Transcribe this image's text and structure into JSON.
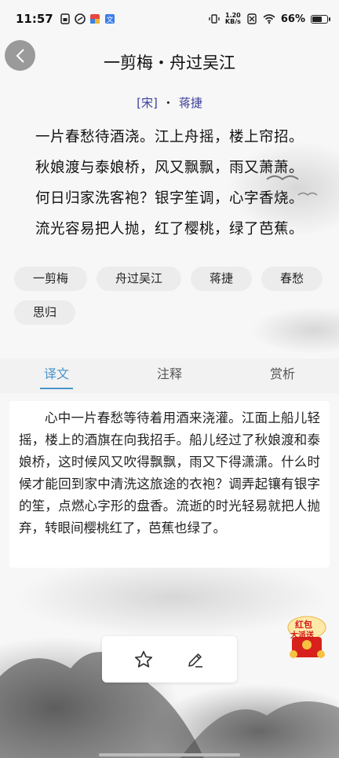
{
  "status_bar": {
    "time": "11:57",
    "net_speed_value": "1.20",
    "net_speed_unit": "KB/s",
    "battery": "66%",
    "battery_level": 0.66
  },
  "header": {
    "title": "一剪梅・舟过吴江",
    "dynasty": "[宋]",
    "separator": "・",
    "author": "蒋捷"
  },
  "poem": {
    "lines": [
      "一片春愁待酒浇。江上舟摇，楼上帘招。",
      "秋娘渡与泰娘桥，风又飘飘，雨又萧萧。",
      "何日归家洗客袍？银字笙调，心字香烧。",
      "流光容易把人抛，红了樱桃，绿了芭蕉。"
    ]
  },
  "tags": [
    "一剪梅",
    "舟过吴江",
    "蒋捷",
    "春愁",
    "思归"
  ],
  "tabs": [
    {
      "label": "译文",
      "active": true
    },
    {
      "label": "注释",
      "active": false
    },
    {
      "label": "赏析",
      "active": false
    }
  ],
  "translation": "心中一片春愁等待着用酒来浇灌。江面上船儿轻摇，楼上的酒旗在向我招手。船儿经过了秋娘渡和泰娘桥，这时候风又吹得飘飘，雨又下得潇潇。什么时候才能回到家中清洗这旅途的衣袍？调弄起镶有银字的笙，点燃心字形的盘香。流逝的时光轻易就把人抛弃，转眼间樱桃红了，芭蕉也绿了。",
  "floating": {
    "red_packet_line1": "红包",
    "red_packet_line2": "大派送"
  },
  "icons": {
    "back": "chevron-left-icon",
    "favorite": "star-icon",
    "edit": "pencil-icon"
  },
  "colors": {
    "accent": "#4a93c9",
    "author_link": "#3b3f9a",
    "tag_bg": "#ececec"
  }
}
